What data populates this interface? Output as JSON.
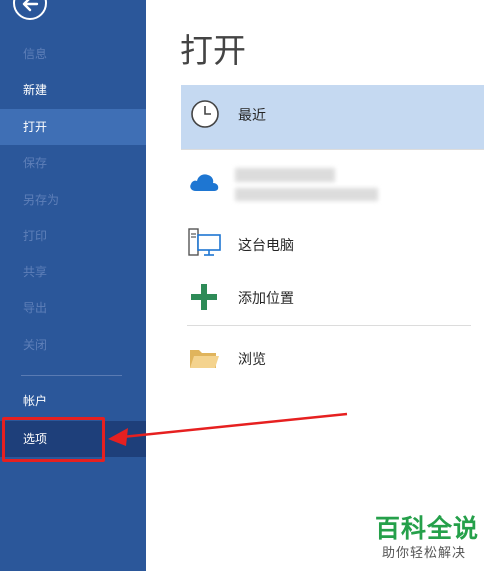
{
  "sidebar": {
    "items": [
      {
        "label": "信息"
      },
      {
        "label": "新建"
      },
      {
        "label": "打开"
      },
      {
        "label": "保存"
      },
      {
        "label": "另存为"
      },
      {
        "label": "打印"
      },
      {
        "label": "共享"
      },
      {
        "label": "导出"
      },
      {
        "label": "关闭"
      },
      {
        "label": "帐户"
      },
      {
        "label": "选项"
      }
    ],
    "colors": {
      "background": "#2b579a",
      "active": "#3f6fb5",
      "highlight": "#1e3f7a"
    }
  },
  "main": {
    "title": "打开",
    "locations": [
      {
        "label": "最近",
        "icon": "clock-icon"
      },
      {
        "label": "",
        "icon": "onedrive-cloud-icon"
      },
      {
        "label": "这台电脑",
        "icon": "computer-icon"
      },
      {
        "label": "添加位置",
        "icon": "plus-icon"
      },
      {
        "label": "浏览",
        "icon": "folder-icon"
      }
    ]
  },
  "annotation": {
    "color": "#e62020"
  },
  "watermark": {
    "title": "百科全说",
    "subtitle": "助你轻松解决"
  }
}
